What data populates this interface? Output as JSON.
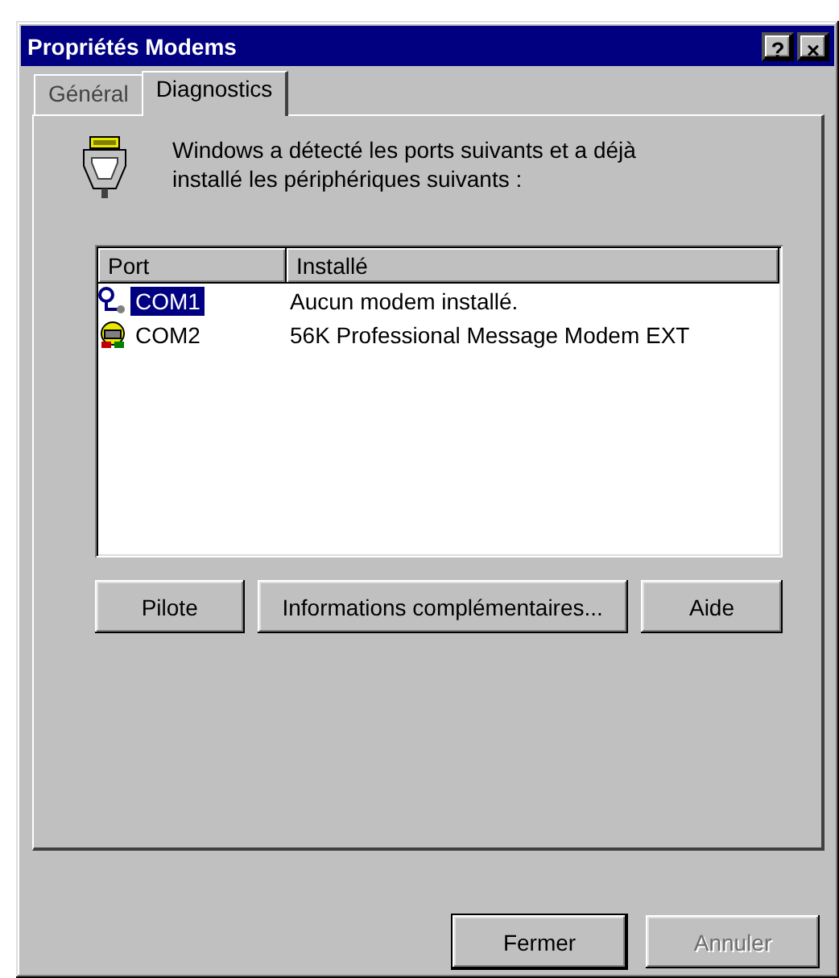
{
  "window": {
    "title": "Propriétés Modems",
    "title_buttons": [
      "?",
      "×"
    ]
  },
  "tabs": [
    {
      "label": "Général",
      "selected": false
    },
    {
      "label": "Diagnostics",
      "selected": true
    }
  ],
  "message": "Windows a détecté les ports suivants et a déjà installé les périphériques suivants :",
  "table": {
    "columns": [
      "Port",
      "Installé"
    ],
    "rows": [
      {
        "kind": "port",
        "cells": [
          "COM1",
          "Aucun modem installé."
        ],
        "selected": true
      },
      {
        "kind": "modem",
        "cells": [
          "COM2",
          "56K Professional Message Modem EXT"
        ],
        "selected": false
      }
    ]
  },
  "table_buttons": [
    {
      "label": "Pilote",
      "disabled": false
    },
    {
      "label": "Informations complémentaires...",
      "disabled": false
    },
    {
      "label": "Aide",
      "disabled": false
    }
  ],
  "dialog_buttons": [
    {
      "label": "Fermer",
      "disabled": false,
      "default": true
    },
    {
      "label": "Annuler",
      "disabled": true,
      "default": false
    }
  ]
}
